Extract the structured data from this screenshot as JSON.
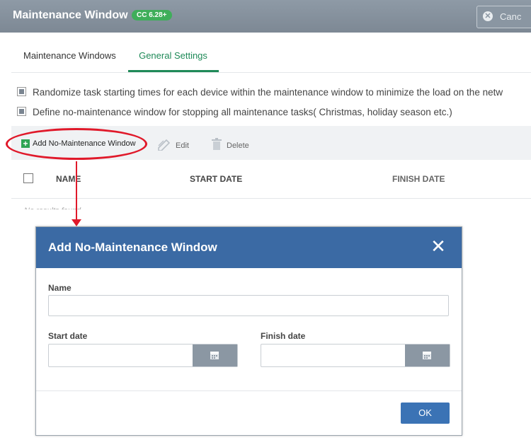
{
  "app": {
    "title": "Maintenance Window",
    "version_badge": "CC 6.28+",
    "cancel_label": "Canc"
  },
  "tabs": [
    {
      "label": "Maintenance Windows",
      "active": false
    },
    {
      "label": "General Settings",
      "active": true
    }
  ],
  "options": [
    {
      "label": "Randomize task starting times for each device within the maintenance window to minimize the load on the netw",
      "checked": true
    },
    {
      "label": "Define no-maintenance window for stopping all maintenance tasks( Christmas, holiday season etc.)",
      "checked": true
    }
  ],
  "toolbar": {
    "add_label": "Add No-Maintenance Window",
    "edit_label": "Edit",
    "delete_label": "Delete"
  },
  "table": {
    "columns": [
      "NAME",
      "START DATE",
      "FINISH DATE"
    ],
    "empty_text": "No results found"
  },
  "dialog": {
    "title": "Add No-Maintenance Window",
    "name_label": "Name",
    "name_value": "",
    "start_label": "Start date",
    "start_value": "",
    "finish_label": "Finish date",
    "finish_value": "",
    "ok_label": "OK"
  },
  "colors": {
    "header_bg": "#8e9aa6",
    "accent_green": "#1f8a58",
    "dialog_header": "#3b6aa4",
    "ok_button": "#3b73b5",
    "annotation_red": "#e0192a"
  }
}
